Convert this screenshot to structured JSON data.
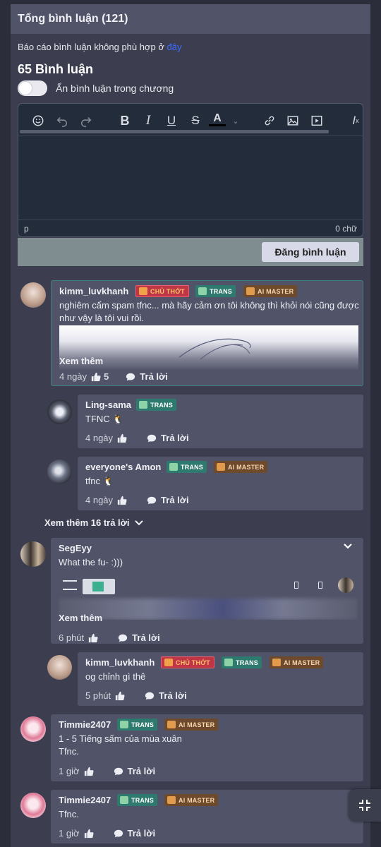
{
  "header": {
    "title": "Tổng bình luận (121)"
  },
  "report": {
    "text": "Báo cáo bình luận không phù hợp ở ",
    "link": "đây"
  },
  "comment_count": "65 Bình luận",
  "hide_toggle": {
    "label": "Ẩn bình luận trong chương",
    "on": false
  },
  "editor": {
    "path": "p",
    "word_count": "0 chữ",
    "submit_label": "Đăng bình luận"
  },
  "badges": {
    "chu_thot": "CHỦ THỚT",
    "trans": "TRANS",
    "ai_master": "AI MASTER"
  },
  "see_more": "Xem thêm",
  "reply_label": "Trả lời",
  "comments": [
    {
      "user": "kimm_luvkhanh",
      "text": "nghiêm cấm spam tfnc... mà hãy cảm ơn tôi không thì khỏi nói cũng được như vậy là tôi vui rồi.",
      "time": "4 ngày",
      "likes": "5"
    },
    {
      "user": "Ling-sama",
      "text": "TFNC 🐧",
      "time": "4 ngày",
      "likes": ""
    },
    {
      "user": "everyone's Amon",
      "text": "tfnc 🐧",
      "time": "4 ngày",
      "likes": ""
    },
    {
      "user": "SegEyy",
      "text": "What the fu- :)))",
      "time": "6 phút",
      "likes": ""
    },
    {
      "user": "kimm_luvkhanh",
      "text": "og chỉnh gì thê",
      "time": "5 phút",
      "likes": ""
    },
    {
      "user": "Timmie2407",
      "text": "1 - 5 Tiếng sấm của mùa xuân\nTfnc.",
      "time": "1 giờ",
      "likes": ""
    },
    {
      "user": "Timmie2407",
      "text": "Tfnc.",
      "time": "1 giờ",
      "likes": ""
    }
  ],
  "replies_more": "Xem thêm 16 trả lời",
  "colors": {
    "panel": "#3c3e50",
    "card": "#515368",
    "accent_link": "#3d6cff",
    "trans": "#2f7a6e",
    "ai_master": "#6e4a2c",
    "chu_thot": "#c03646"
  }
}
